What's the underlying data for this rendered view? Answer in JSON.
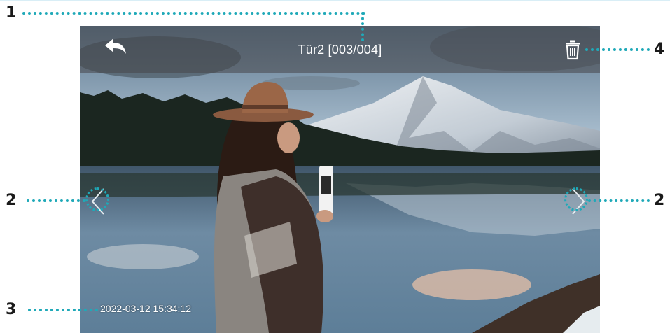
{
  "viewer": {
    "title": "Tür2 [003/004]",
    "timestamp": "2022-03-12 15:34:12"
  },
  "icons": {
    "back": "back-arrow-icon",
    "delete": "trash-icon",
    "prev": "chevron-left-icon",
    "next": "chevron-right-icon"
  },
  "annotations": {
    "title_marker": "1",
    "left_nav_marker": "2",
    "right_nav_marker": "2",
    "timestamp_marker": "3",
    "delete_marker": "4"
  },
  "colors": {
    "annotation": "#1fa9b8",
    "toolbar": "#464648",
    "text": "#ffffff"
  }
}
